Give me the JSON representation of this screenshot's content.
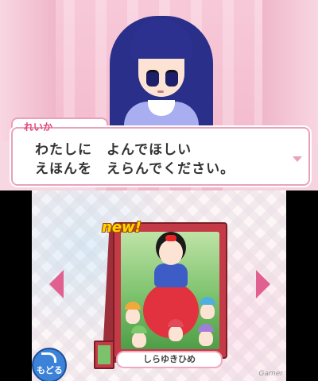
{
  "dialog": {
    "speaker": "れいか",
    "lines": [
      "わたしに　よんでほしい",
      "えほんを　えらんでください。"
    ]
  },
  "book_select": {
    "new_label": "new!",
    "current_title": "しらゆきひめ",
    "back_label": "もどる"
  },
  "watermark": "Gamer",
  "colors": {
    "name_pink": "#e24480",
    "dialog_border": "#e9a2ba",
    "book_red": "#c43b47",
    "arrow_pink": "#e0608f",
    "back_blue": "#3c82d8"
  },
  "icons": [
    "left-arrow-icon",
    "right-arrow-icon",
    "back-return-icon"
  ]
}
